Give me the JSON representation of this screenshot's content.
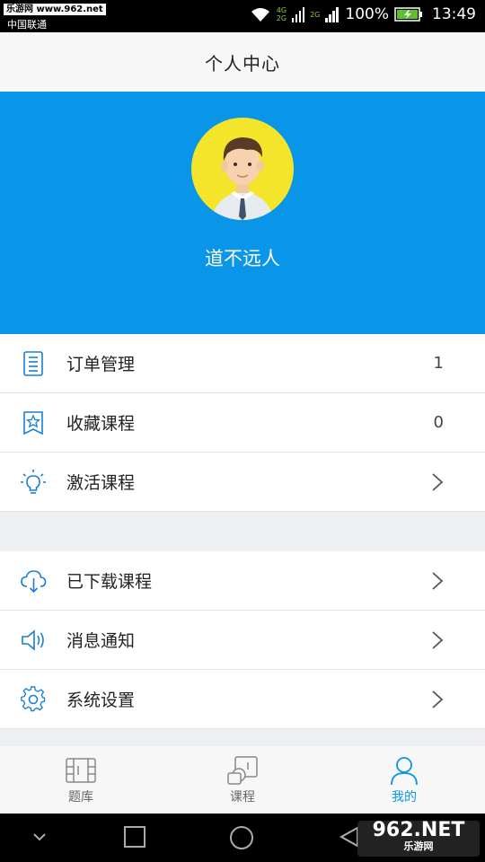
{
  "status_bar": {
    "watermark": "乐游网 www.962.net",
    "carrier": "中国联通",
    "network_1": "4G",
    "network_1b": "2G",
    "network_2": "2G",
    "battery": "100%",
    "time": "13:49"
  },
  "header": {
    "title": "个人中心"
  },
  "profile": {
    "username": "道不远人",
    "avatar_bg": "#f4e52a",
    "banner_color": "#0995e8"
  },
  "menu_group_1": [
    {
      "label": "订单管理",
      "count": "1",
      "icon": "document-icon"
    },
    {
      "label": "收藏课程",
      "count": "0",
      "icon": "bookmark-star-icon"
    },
    {
      "label": "激活课程",
      "icon": "lightbulb-icon"
    }
  ],
  "menu_group_2": [
    {
      "label": "已下载课程",
      "icon": "cloud-download-icon"
    },
    {
      "label": "消息通知",
      "icon": "speaker-icon"
    },
    {
      "label": "系统设置",
      "icon": "gear-icon"
    }
  ],
  "tabbar": [
    {
      "label": "题库",
      "icon": "question-bank-icon",
      "active": false
    },
    {
      "label": "课程",
      "icon": "course-icon",
      "active": false
    },
    {
      "label": "我的",
      "icon": "user-icon",
      "active": true
    }
  ],
  "navbar": {
    "watermark_main": "962.NET",
    "watermark_sub": "乐游网"
  },
  "colors": {
    "accent": "#0995e8",
    "icon_blue": "#1a7fd0",
    "text": "#222222"
  }
}
